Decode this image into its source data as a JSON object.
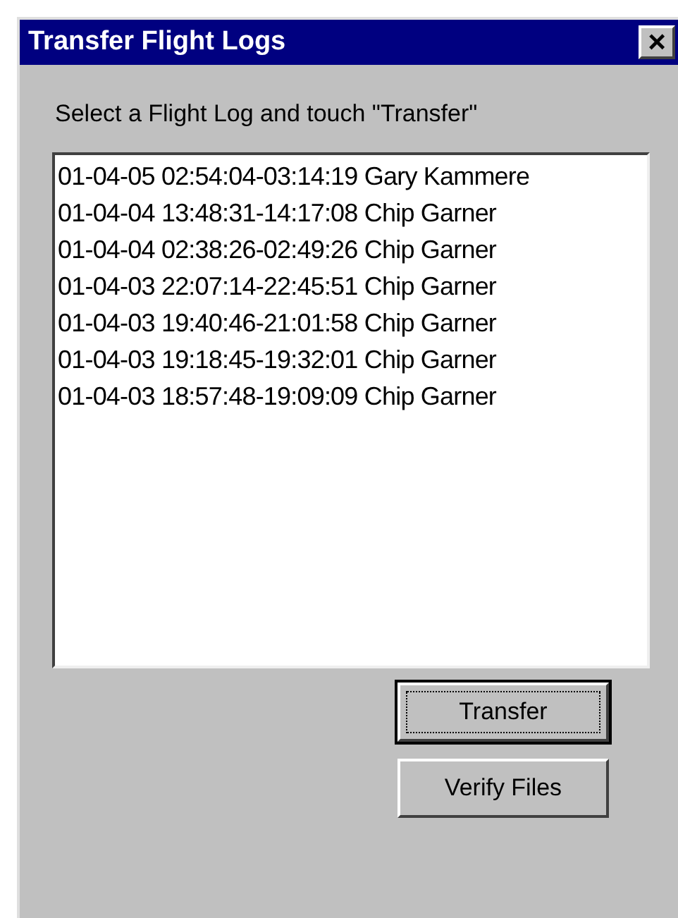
{
  "window": {
    "title": "Transfer Flight Logs",
    "close": "×"
  },
  "instruction": "Select a Flight Log and touch \"Transfer\"",
  "logs": [
    {
      "text": "01-04-05 02:54:04-03:14:19 Gary Kammere",
      "selected": false
    },
    {
      "text": "01-04-04 13:48:31-14:17:08 Chip Garner",
      "selected": false
    },
    {
      "text": "01-04-04 02:38:26-02:49:26 Chip Garner",
      "selected": false
    },
    {
      "text": "01-04-03 22:07:14-22:45:51 Chip Garner",
      "selected": false
    },
    {
      "text": "01-04-03 19:40:46-21:01:58 Chip Garner",
      "selected": false
    },
    {
      "text": "01-04-03 19:18:45-19:32:01 Chip Garner",
      "selected": false
    },
    {
      "text": "01-04-03 18:57:48-19:09:09 Chip Garner",
      "selected": false
    }
  ],
  "buttons": [
    {
      "label": "Transfer",
      "focused": true
    },
    {
      "label": "Verify Files",
      "focused": false
    }
  ]
}
